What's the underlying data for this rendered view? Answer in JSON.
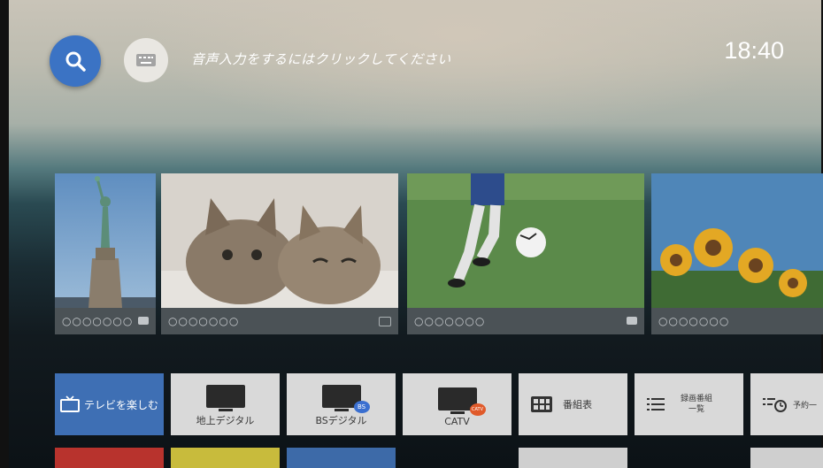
{
  "top_bar": {
    "search_icon": "search-icon",
    "keyboard_icon": "keyboard-icon",
    "voice_prompt": "音声入力をするにはクリックしてください",
    "clock": "18:40"
  },
  "cards": [
    {
      "caption": "○○○○○○○",
      "icon": "small-badge-icon"
    },
    {
      "caption": "○○○○○○○",
      "icon": "screen-icon"
    },
    {
      "caption": "○○○○○○○",
      "icon": "video-icon"
    },
    {
      "caption": "○○○○○○○",
      "icon": ""
    }
  ],
  "tiles": [
    {
      "label": "テレビを楽しむ",
      "icon": "tv-outline-icon"
    },
    {
      "label": "地上デジタル",
      "icon": "tv-icon"
    },
    {
      "label": "BSデジタル",
      "icon": "tv-icon",
      "badge": "BS",
      "badge_color": "#3a6fd0"
    },
    {
      "label": "CATV",
      "icon": "tv-icon",
      "badge": "CATV",
      "badge_color": "#e05a2a"
    },
    {
      "label": "番組表",
      "icon": "grid-icon"
    },
    {
      "label": "録画番組\n一覧",
      "icon": "list-icon"
    },
    {
      "label": "予約一",
      "icon": "list-clock-icon"
    }
  ],
  "bottom_colors": [
    "#b8332d",
    "#c8bb3c",
    "#3d6aa8",
    "#cfcfcf",
    "#cfcfcf"
  ],
  "colors": {
    "accent_blue": "#3b73c4",
    "tile_bg": "#d9d9d9",
    "highlight_tile": "#3e6fb4"
  }
}
